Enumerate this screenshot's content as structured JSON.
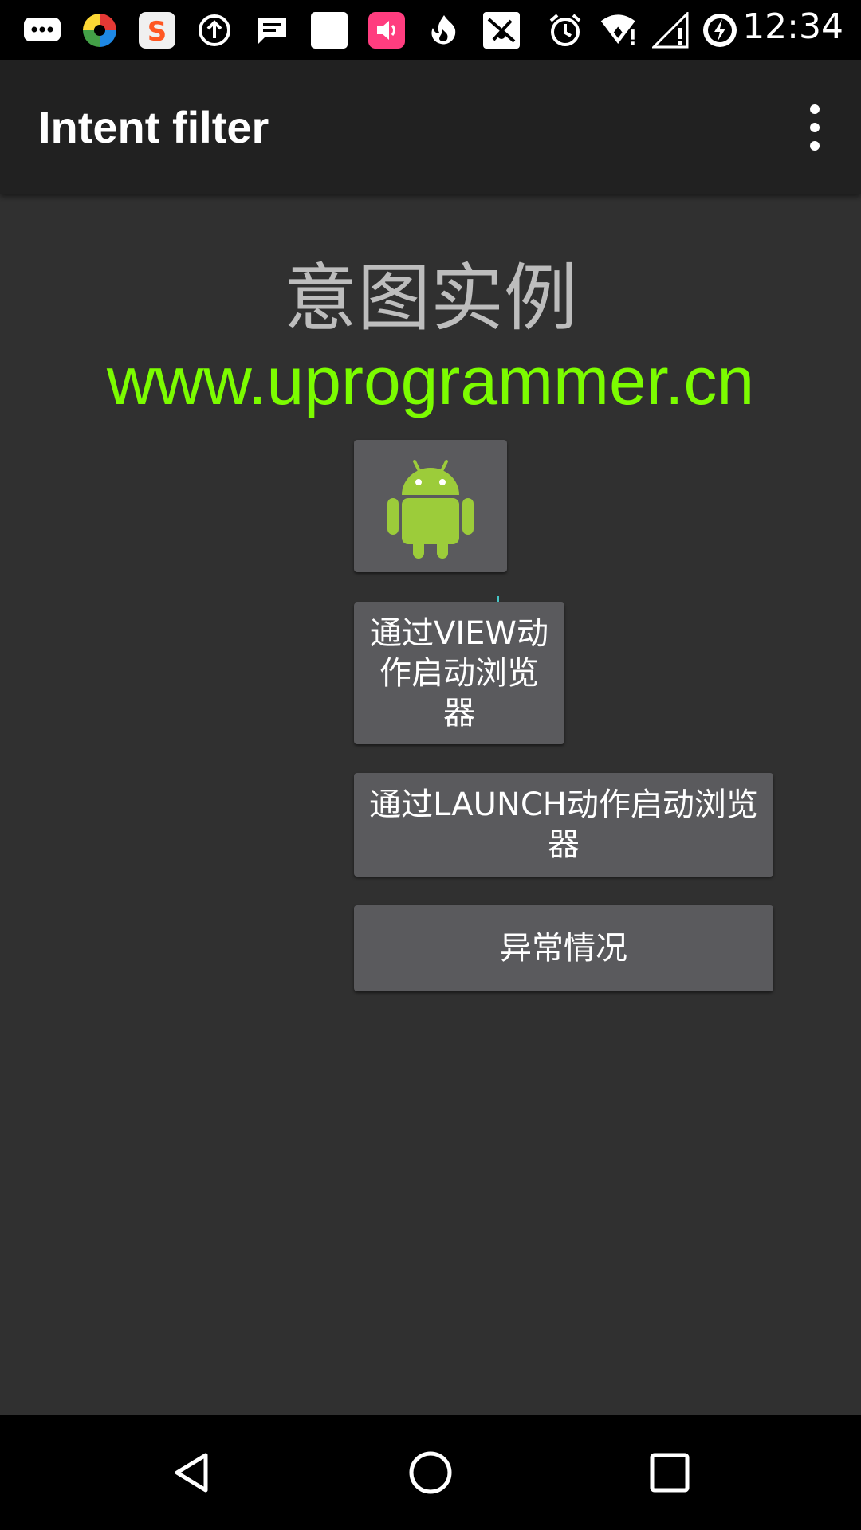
{
  "status_bar": {
    "time": "12:34",
    "icons": [
      "chat-bubble-icon",
      "pinwheel-app-icon",
      "sogou-input-icon",
      "upload-icon",
      "message-icon",
      "blank-square-icon",
      "volume-app-icon",
      "flame-app-icon",
      "bird-app-icon",
      "alarm-icon",
      "wifi-icon",
      "signal-icon",
      "battery-charging-icon"
    ]
  },
  "app_bar": {
    "title": "Intent filter",
    "overflow_icon": "more-vert-icon"
  },
  "content": {
    "heading": "意图实例",
    "url": "www.uprogrammer.cn",
    "image_button_icon": "android-robot-icon",
    "buttons": {
      "view": "通过VIEW动作启动浏览器",
      "launch": "通过LAUNCH动作启动浏览器",
      "exception": "异常情况"
    }
  },
  "nav_bar": {
    "icons": [
      "back-icon",
      "home-icon",
      "recents-icon"
    ]
  },
  "colors": {
    "background": "#303030",
    "app_bar": "#212121",
    "heading_text": "#bdbdbd",
    "url_text": "#7cfc00",
    "button_bg": "#5a5a5d"
  }
}
